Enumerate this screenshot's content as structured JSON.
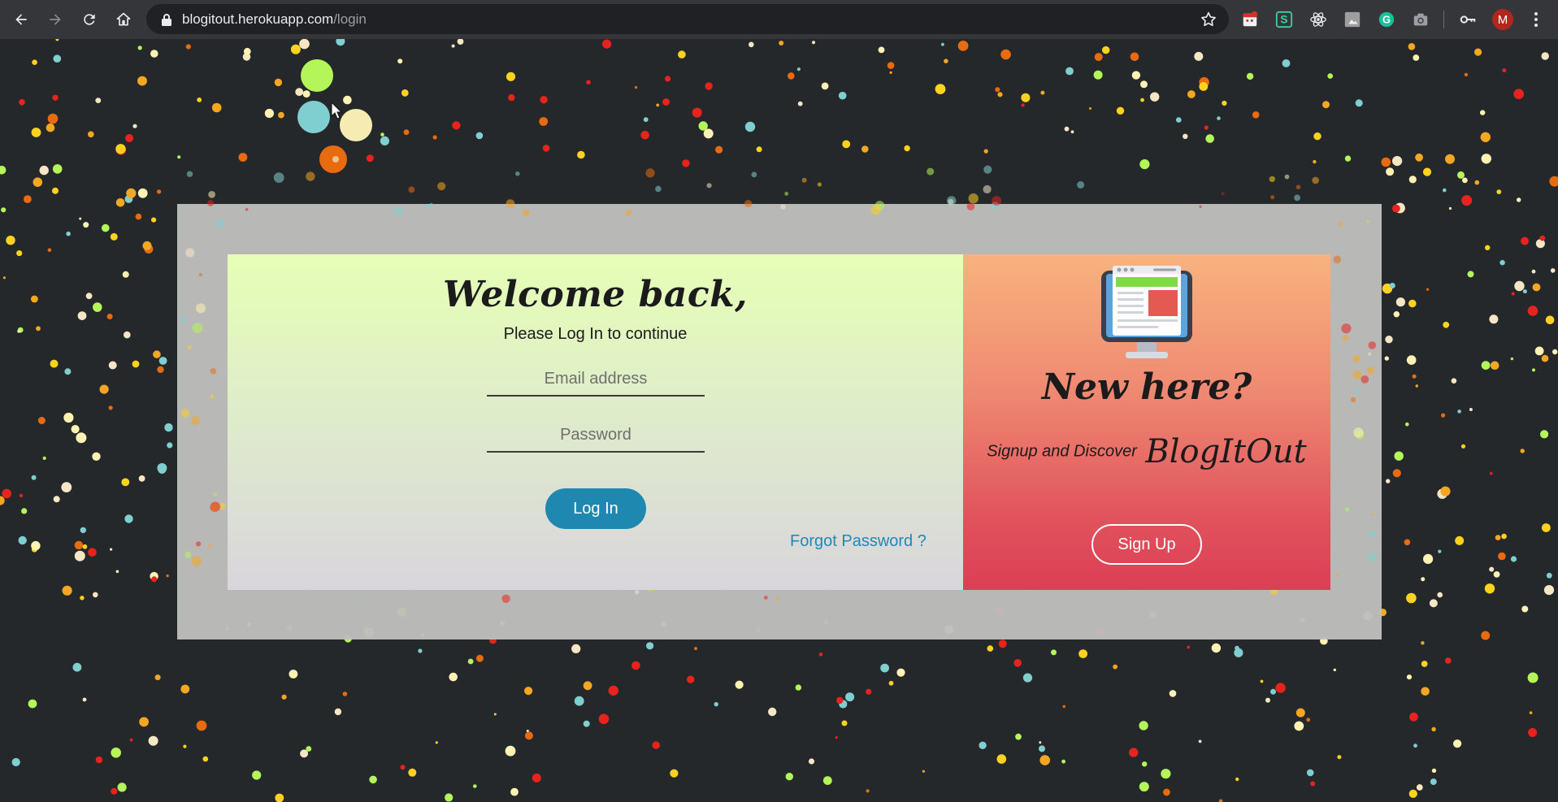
{
  "browser": {
    "url_host": "blogitout.herokuapp.com",
    "url_path": "/login",
    "profile_initial": "M",
    "extensions": [
      "calendar-extension-icon",
      "s-extension-icon",
      "react-devtools-icon",
      "image-extension-icon",
      "grammarly-icon",
      "camera-icon"
    ]
  },
  "login": {
    "heading": "Welcome back,",
    "subtitle": "Please Log In to continue",
    "email_placeholder": "Email address",
    "password_placeholder": "Password",
    "login_label": "Log In",
    "forgot_label": "Forgot Password ?"
  },
  "signup": {
    "heading": "New here?",
    "discover_text": "Signup and Discover",
    "brand": "BlogItOut",
    "signup_label": "Sign Up"
  },
  "colors": {
    "page_bg": "#25282b",
    "login_button": "#1e88b0",
    "forgot_link": "#1e8ab5",
    "dot_palette": [
      "#e8231d",
      "#f5a623",
      "#ffd21f",
      "#b4f55a",
      "#7fcfd0",
      "#fff2b3",
      "#e86b10",
      "#f7e6c4"
    ]
  }
}
